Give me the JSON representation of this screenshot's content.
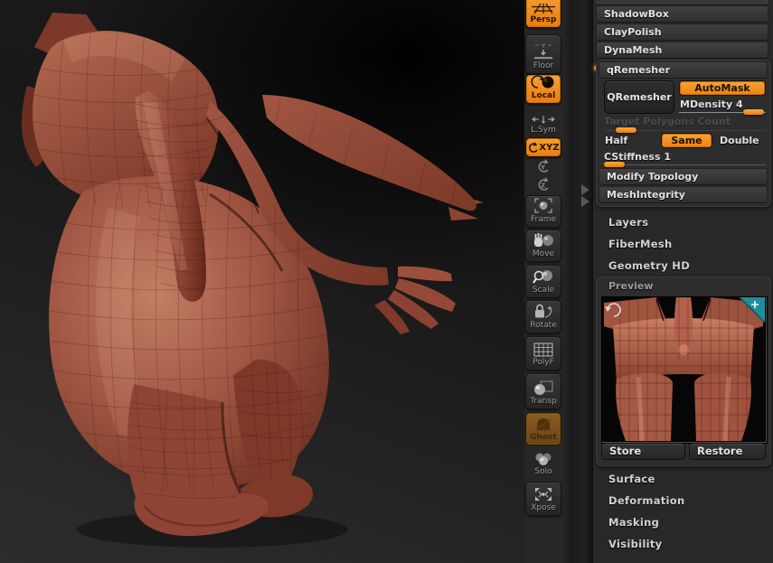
{
  "accent_color": "#ee8412",
  "viewport": {
    "description": "low-poly terracotta creature sculpt",
    "model_color": "#9a4c39",
    "background": "#1a1a1a"
  },
  "toolbar": {
    "persp": "Persp",
    "floor": "Floor",
    "local": "Local",
    "lsym": "L.Sym",
    "xyz": "XYZ",
    "frame": "Frame",
    "move": "Move",
    "scale": "Scale",
    "rotate": "Rotate",
    "polyf": "PolyF",
    "transp": "Transp",
    "ghost": "Ghost",
    "solo": "Solo",
    "xpose": "Xpose"
  },
  "icons": [
    "perspective-grid-icon",
    "floor-snap-icon",
    "local-pivot-icon",
    "lateral-symmetry-icon",
    "rotate-xyz-icon",
    "rotate-y-icon",
    "rotate-z-icon",
    "frame-icon",
    "move-hand-icon",
    "scale-magnifier-icon",
    "rotate-lock-icon",
    "polyframe-grid-icon",
    "transparency-icon",
    "ghost-icon",
    "solo-spheres-icon",
    "xpose-arrows-icon",
    "preview-rotate-icon",
    "preview-add-icon"
  ],
  "panel": {
    "headers": {
      "shadowbox": "ShadowBox",
      "claypolish": "ClayPolish",
      "dynamesh": "DynaMesh",
      "qremesher": "qRemesher",
      "modify_topology": "Modify Topology",
      "meshintegrity": "MeshIntegrity"
    },
    "qremesher": {
      "button": "QRemesher",
      "automask": "AutoMask",
      "mdensity_label": "MDensity",
      "mdensity_value": "4",
      "target_label": "Target Polygons Count",
      "half": "Half",
      "same": "Same",
      "double": "Double",
      "cstiffness_label": "CStiffness",
      "cstiffness_value": "1"
    },
    "collapsed_mid": [
      "Layers",
      "FiberMesh",
      "Geometry HD"
    ],
    "preview": {
      "title": "Preview",
      "store": "Store",
      "restore": "Restore"
    },
    "collapsed_bottom": [
      "Surface",
      "Deformation",
      "Masking",
      "Visibility"
    ]
  }
}
